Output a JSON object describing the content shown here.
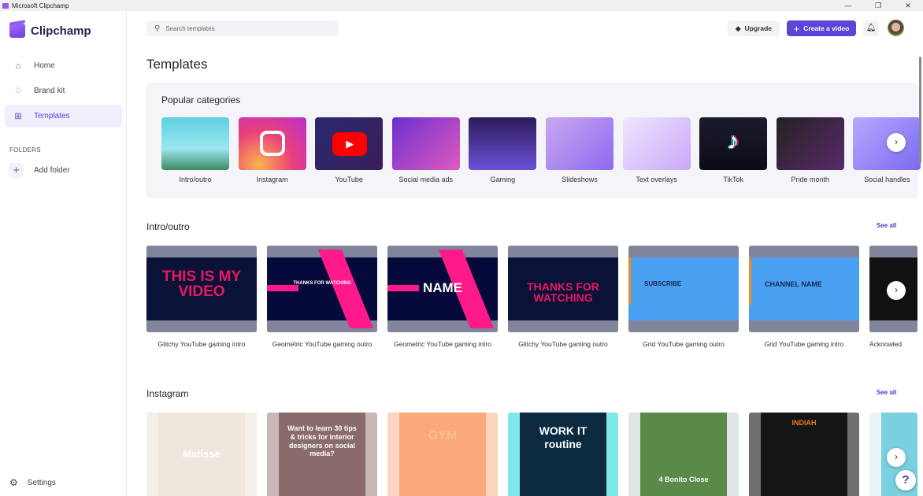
{
  "window": {
    "title": "Microsoft Clipchamp",
    "controls": [
      "—",
      "❐",
      "✕"
    ]
  },
  "sidebar": {
    "brand": "Clipchamp",
    "items": [
      {
        "label": "Home",
        "icon": "home-icon"
      },
      {
        "label": "Brand kit",
        "icon": "brand-kit-icon"
      },
      {
        "label": "Templates",
        "icon": "templates-icon",
        "active": true
      }
    ],
    "folders_heading": "FOLDERS",
    "add_folder": "Add folder",
    "settings": "Settings"
  },
  "header": {
    "search_placeholder": "Search templates",
    "upgrade": "Upgrade",
    "create": "Create a video"
  },
  "page_title": "Templates",
  "popular": {
    "title": "Popular categories",
    "categories": [
      "Intro/outro",
      "Instagram",
      "YouTube",
      "Social media ads",
      "Gaming",
      "Slideshows",
      "Text overlays",
      "TikTok",
      "Pride month",
      "Social handles"
    ]
  },
  "intro": {
    "title": "Intro/outro",
    "see_all": "See all",
    "cards": [
      {
        "label": "Glitchy YouTube gaming intro",
        "text": "THIS IS MY VIDEO"
      },
      {
        "label": "Geometric YouTube gaming outro",
        "text": "THANKS FOR WATCHING"
      },
      {
        "label": "Geometric YouTube gaming intro",
        "text": "NAME"
      },
      {
        "label": "Glitchy YouTube gaming outro",
        "text": "THANKS FOR WATCHING"
      },
      {
        "label": "Grid YouTube gaming outro",
        "text": "SUBSCRIBE"
      },
      {
        "label": "Grid YouTube gaming intro",
        "text": "CHANNEL NAME"
      },
      {
        "label": "Acknowled",
        "text": ""
      }
    ]
  },
  "instagram": {
    "title": "Instagram",
    "see_all": "See all",
    "cards": [
      {
        "text": "Matisse"
      },
      {
        "text": "Want to learn 30 tips & tricks for interior designers on social media?"
      },
      {
        "text": "GYM"
      },
      {
        "text": "WORK IT routine"
      },
      {
        "text": "4 Bonito Close"
      },
      {
        "text": "INDIAH"
      },
      {
        "text": ""
      }
    ]
  },
  "help": "?",
  "colors": {
    "accent": "#5b45d6",
    "link": "#4b3bc4"
  }
}
